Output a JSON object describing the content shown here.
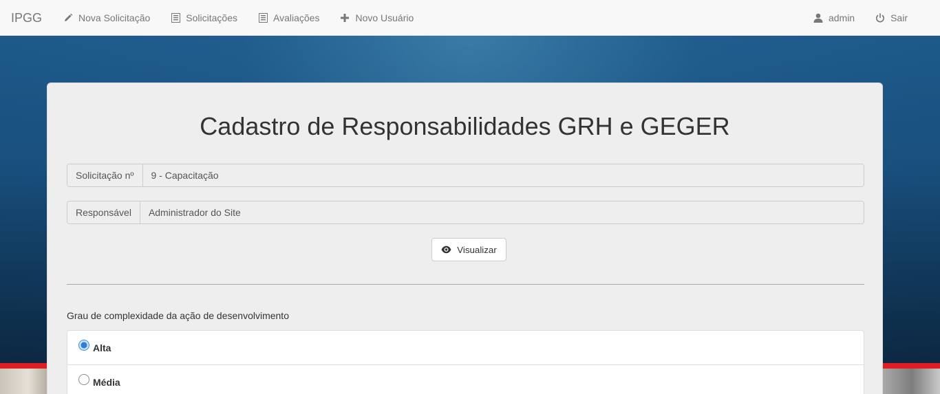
{
  "navbar": {
    "brand": "IPGG",
    "items": [
      {
        "label": "Nova Solicitação",
        "icon": "pencil-icon"
      },
      {
        "label": "Solicitações",
        "icon": "list-icon"
      },
      {
        "label": "Avaliações",
        "icon": "list-icon"
      },
      {
        "label": "Novo Usuário",
        "icon": "plus-icon"
      }
    ],
    "user": {
      "label": "admin",
      "icon": "user-icon"
    },
    "logout": {
      "label": "Sair",
      "icon": "power-icon"
    }
  },
  "form": {
    "title": "Cadastro de Responsabilidades GRH e GEGER",
    "solicitacao": {
      "label": "Solicitação nº",
      "value": "9 - Capacitação"
    },
    "responsavel": {
      "label": "Responsável",
      "value": "Administrador do Site"
    },
    "view_button": {
      "label": "Visualizar",
      "icon": "eye-icon"
    },
    "question": "Grau de complexidade da ação de desenvolvimento",
    "options": [
      {
        "label": "Alta",
        "selected": true
      },
      {
        "label": "Média",
        "selected": false
      }
    ]
  },
  "colors": {
    "accent_red": "#e11d24",
    "background_blue": "#1d5a8a",
    "radio_selected": "#2a7fd6"
  }
}
